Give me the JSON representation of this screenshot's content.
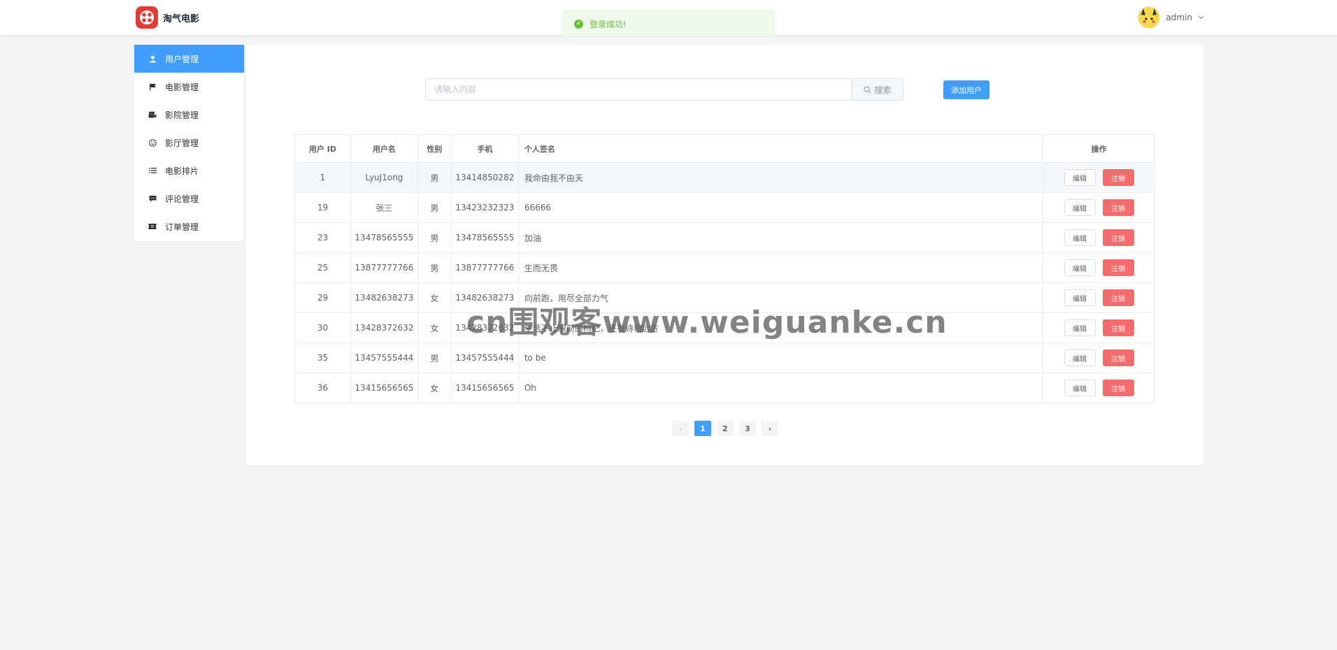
{
  "header": {
    "brand": "淘气电影",
    "username": "admin"
  },
  "toast": {
    "message": "登录成功!"
  },
  "sidebar": {
    "items": [
      {
        "label": "用户管理",
        "icon": "user-icon",
        "active": true
      },
      {
        "label": "电影管理",
        "icon": "flag-icon",
        "active": false
      },
      {
        "label": "影院管理",
        "icon": "camera-icon",
        "active": false
      },
      {
        "label": "影厅管理",
        "icon": "smiley-icon",
        "active": false
      },
      {
        "label": "电影排片",
        "icon": "list-icon",
        "active": false
      },
      {
        "label": "评论管理",
        "icon": "comment-icon",
        "active": false
      },
      {
        "label": "订单管理",
        "icon": "ticket-icon",
        "active": false
      }
    ]
  },
  "toolbar": {
    "search_placeholder": "请输入内容",
    "search_label": "搜索",
    "add_label": "添加用户"
  },
  "table": {
    "headers": {
      "id": "用户 ID",
      "name": "用户名",
      "gender": "性别",
      "phone": "手机",
      "signature": "个人签名",
      "actions": "操作"
    },
    "edit_label": "编辑",
    "delete_label": "注销",
    "rows": [
      {
        "id": "1",
        "name": "LyuJ1ong",
        "gender": "男",
        "phone": "13414850282",
        "signature": "我命由我不由天"
      },
      {
        "id": "19",
        "name": "张三",
        "gender": "男",
        "phone": "13423232323",
        "signature": "66666"
      },
      {
        "id": "23",
        "name": "13478565555",
        "gender": "男",
        "phone": "13478565555",
        "signature": "加油"
      },
      {
        "id": "25",
        "name": "13877777766",
        "gender": "男",
        "phone": "13877777766",
        "signature": "生而无畏"
      },
      {
        "id": "29",
        "name": "13482638273",
        "gender": "女",
        "phone": "13482638273",
        "signature": "向前跑，用尽全部力气"
      },
      {
        "id": "30",
        "name": "13428372632",
        "gender": "女",
        "phone": "13428372632",
        "signature": "生活不止眼前的枸杞，还有诗和远方"
      },
      {
        "id": "35",
        "name": "13457555444",
        "gender": "男",
        "phone": "13457555444",
        "signature": "to be"
      },
      {
        "id": "36",
        "name": "13415656565",
        "gender": "女",
        "phone": "13415656565",
        "signature": "Oh"
      }
    ]
  },
  "pagination": {
    "pages": [
      "1",
      "2",
      "3"
    ],
    "current": "1",
    "prev": "‹",
    "next": "›"
  },
  "watermark": "cn围观客www.weiguanke.cn",
  "colors": {
    "primary": "#409eff",
    "danger": "#f56c6c",
    "success": "#67c23a",
    "brand": "#e03b37"
  }
}
